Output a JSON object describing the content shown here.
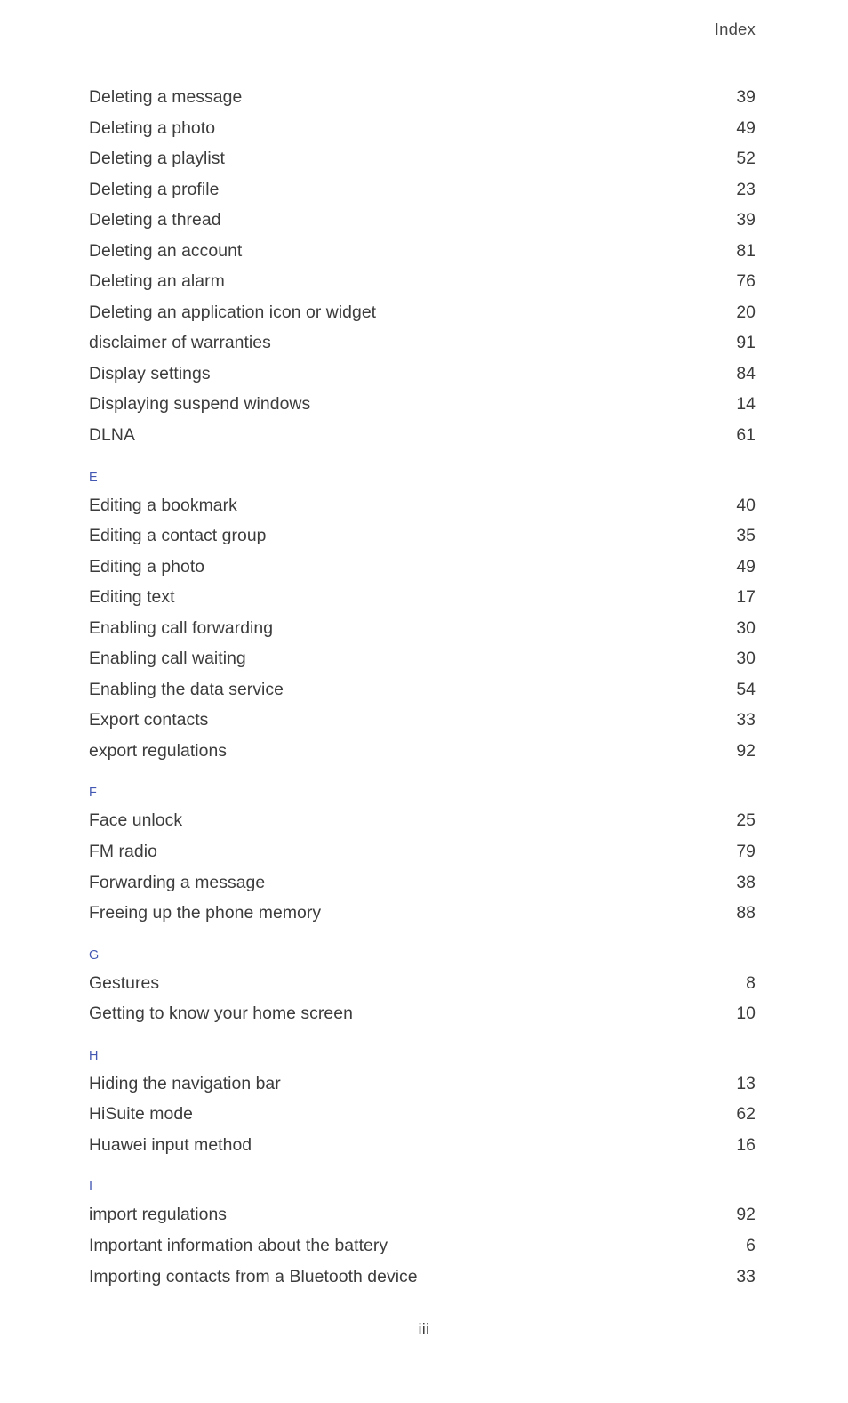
{
  "header": {
    "running_head": "Index"
  },
  "footer": {
    "folio": "iii"
  },
  "colors": {
    "section_letter": "#4257b2",
    "body_text": "#3c3c3c",
    "page_background": "#ffffff"
  },
  "index": {
    "sections": [
      {
        "letter": "",
        "entries": [
          {
            "title": "Deleting a message",
            "page": "39"
          },
          {
            "title": "Deleting a photo",
            "page": "49"
          },
          {
            "title": "Deleting a playlist",
            "page": "52"
          },
          {
            "title": "Deleting a profile",
            "page": "23"
          },
          {
            "title": "Deleting a thread",
            "page": "39"
          },
          {
            "title": "Deleting an account",
            "page": "81"
          },
          {
            "title": "Deleting an alarm",
            "page": "76"
          },
          {
            "title": "Deleting an application icon or widget",
            "page": "20"
          },
          {
            "title": "disclaimer of warranties",
            "page": "91"
          },
          {
            "title": "Display settings",
            "page": "84"
          },
          {
            "title": "Displaying suspend windows",
            "page": "14"
          },
          {
            "title": "DLNA",
            "page": "61"
          }
        ]
      },
      {
        "letter": "E",
        "entries": [
          {
            "title": "Editing a bookmark",
            "page": "40"
          },
          {
            "title": "Editing a contact group",
            "page": "35"
          },
          {
            "title": "Editing a photo",
            "page": "49"
          },
          {
            "title": "Editing text",
            "page": "17"
          },
          {
            "title": "Enabling call forwarding",
            "page": "30"
          },
          {
            "title": "Enabling call waiting",
            "page": "30"
          },
          {
            "title": "Enabling the data service",
            "page": "54"
          },
          {
            "title": "Export contacts",
            "page": "33"
          },
          {
            "title": "export regulations",
            "page": "92"
          }
        ]
      },
      {
        "letter": "F",
        "entries": [
          {
            "title": "Face unlock",
            "page": "25"
          },
          {
            "title": "FM radio",
            "page": "79"
          },
          {
            "title": "Forwarding a message",
            "page": "38"
          },
          {
            "title": "Freeing up the phone memory",
            "page": "88"
          }
        ]
      },
      {
        "letter": "G",
        "entries": [
          {
            "title": "Gestures",
            "page": "8"
          },
          {
            "title": "Getting to know your home screen",
            "page": "10"
          }
        ]
      },
      {
        "letter": "H",
        "entries": [
          {
            "title": "Hiding the navigation bar",
            "page": "13"
          },
          {
            "title": "HiSuite mode",
            "page": "62"
          },
          {
            "title": "Huawei input method",
            "page": "16"
          }
        ]
      },
      {
        "letter": "I",
        "entries": [
          {
            "title": "import regulations",
            "page": "92"
          },
          {
            "title": "Important information about the battery",
            "page": "6"
          },
          {
            "title": "Importing contacts from a Bluetooth device",
            "page": "33"
          }
        ]
      }
    ]
  }
}
